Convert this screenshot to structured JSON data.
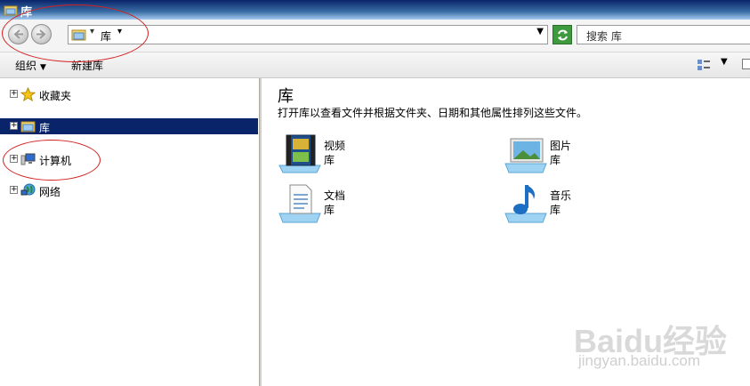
{
  "window": {
    "title": "库"
  },
  "address": {
    "crumb": "库",
    "separator": "▾",
    "crumb_dropdown": "▾",
    "history_dropdown": "▼"
  },
  "search": {
    "placeholder": "搜索 库"
  },
  "toolbar": {
    "organize": "组织",
    "organize_dd": "▼",
    "new_library": "新建库",
    "view_dd": "▼"
  },
  "sidebar": {
    "items": [
      {
        "label": "收藏夹",
        "expander": "+"
      },
      {
        "label": "库",
        "expander": "+"
      },
      {
        "label": "计算机",
        "expander": "+"
      },
      {
        "label": "网络",
        "expander": "+"
      }
    ]
  },
  "content": {
    "title": "库",
    "description": "打开库以查看文件并根据文件夹、日期和其他属性排列这些文件。",
    "libraries": [
      {
        "name": "视频",
        "type": "库",
        "icon": "video-library-icon"
      },
      {
        "name": "图片",
        "type": "库",
        "icon": "pictures-library-icon"
      },
      {
        "name": "文档",
        "type": "库",
        "icon": "documents-library-icon"
      },
      {
        "name": "音乐",
        "type": "库",
        "icon": "music-library-icon"
      }
    ]
  },
  "watermark": {
    "brand": "Baidu经验",
    "url": "jingyan.baidu.com"
  },
  "colors": {
    "selection": "#0a246a",
    "annotation": "#d42020",
    "refresh": "#3e9a3e"
  }
}
